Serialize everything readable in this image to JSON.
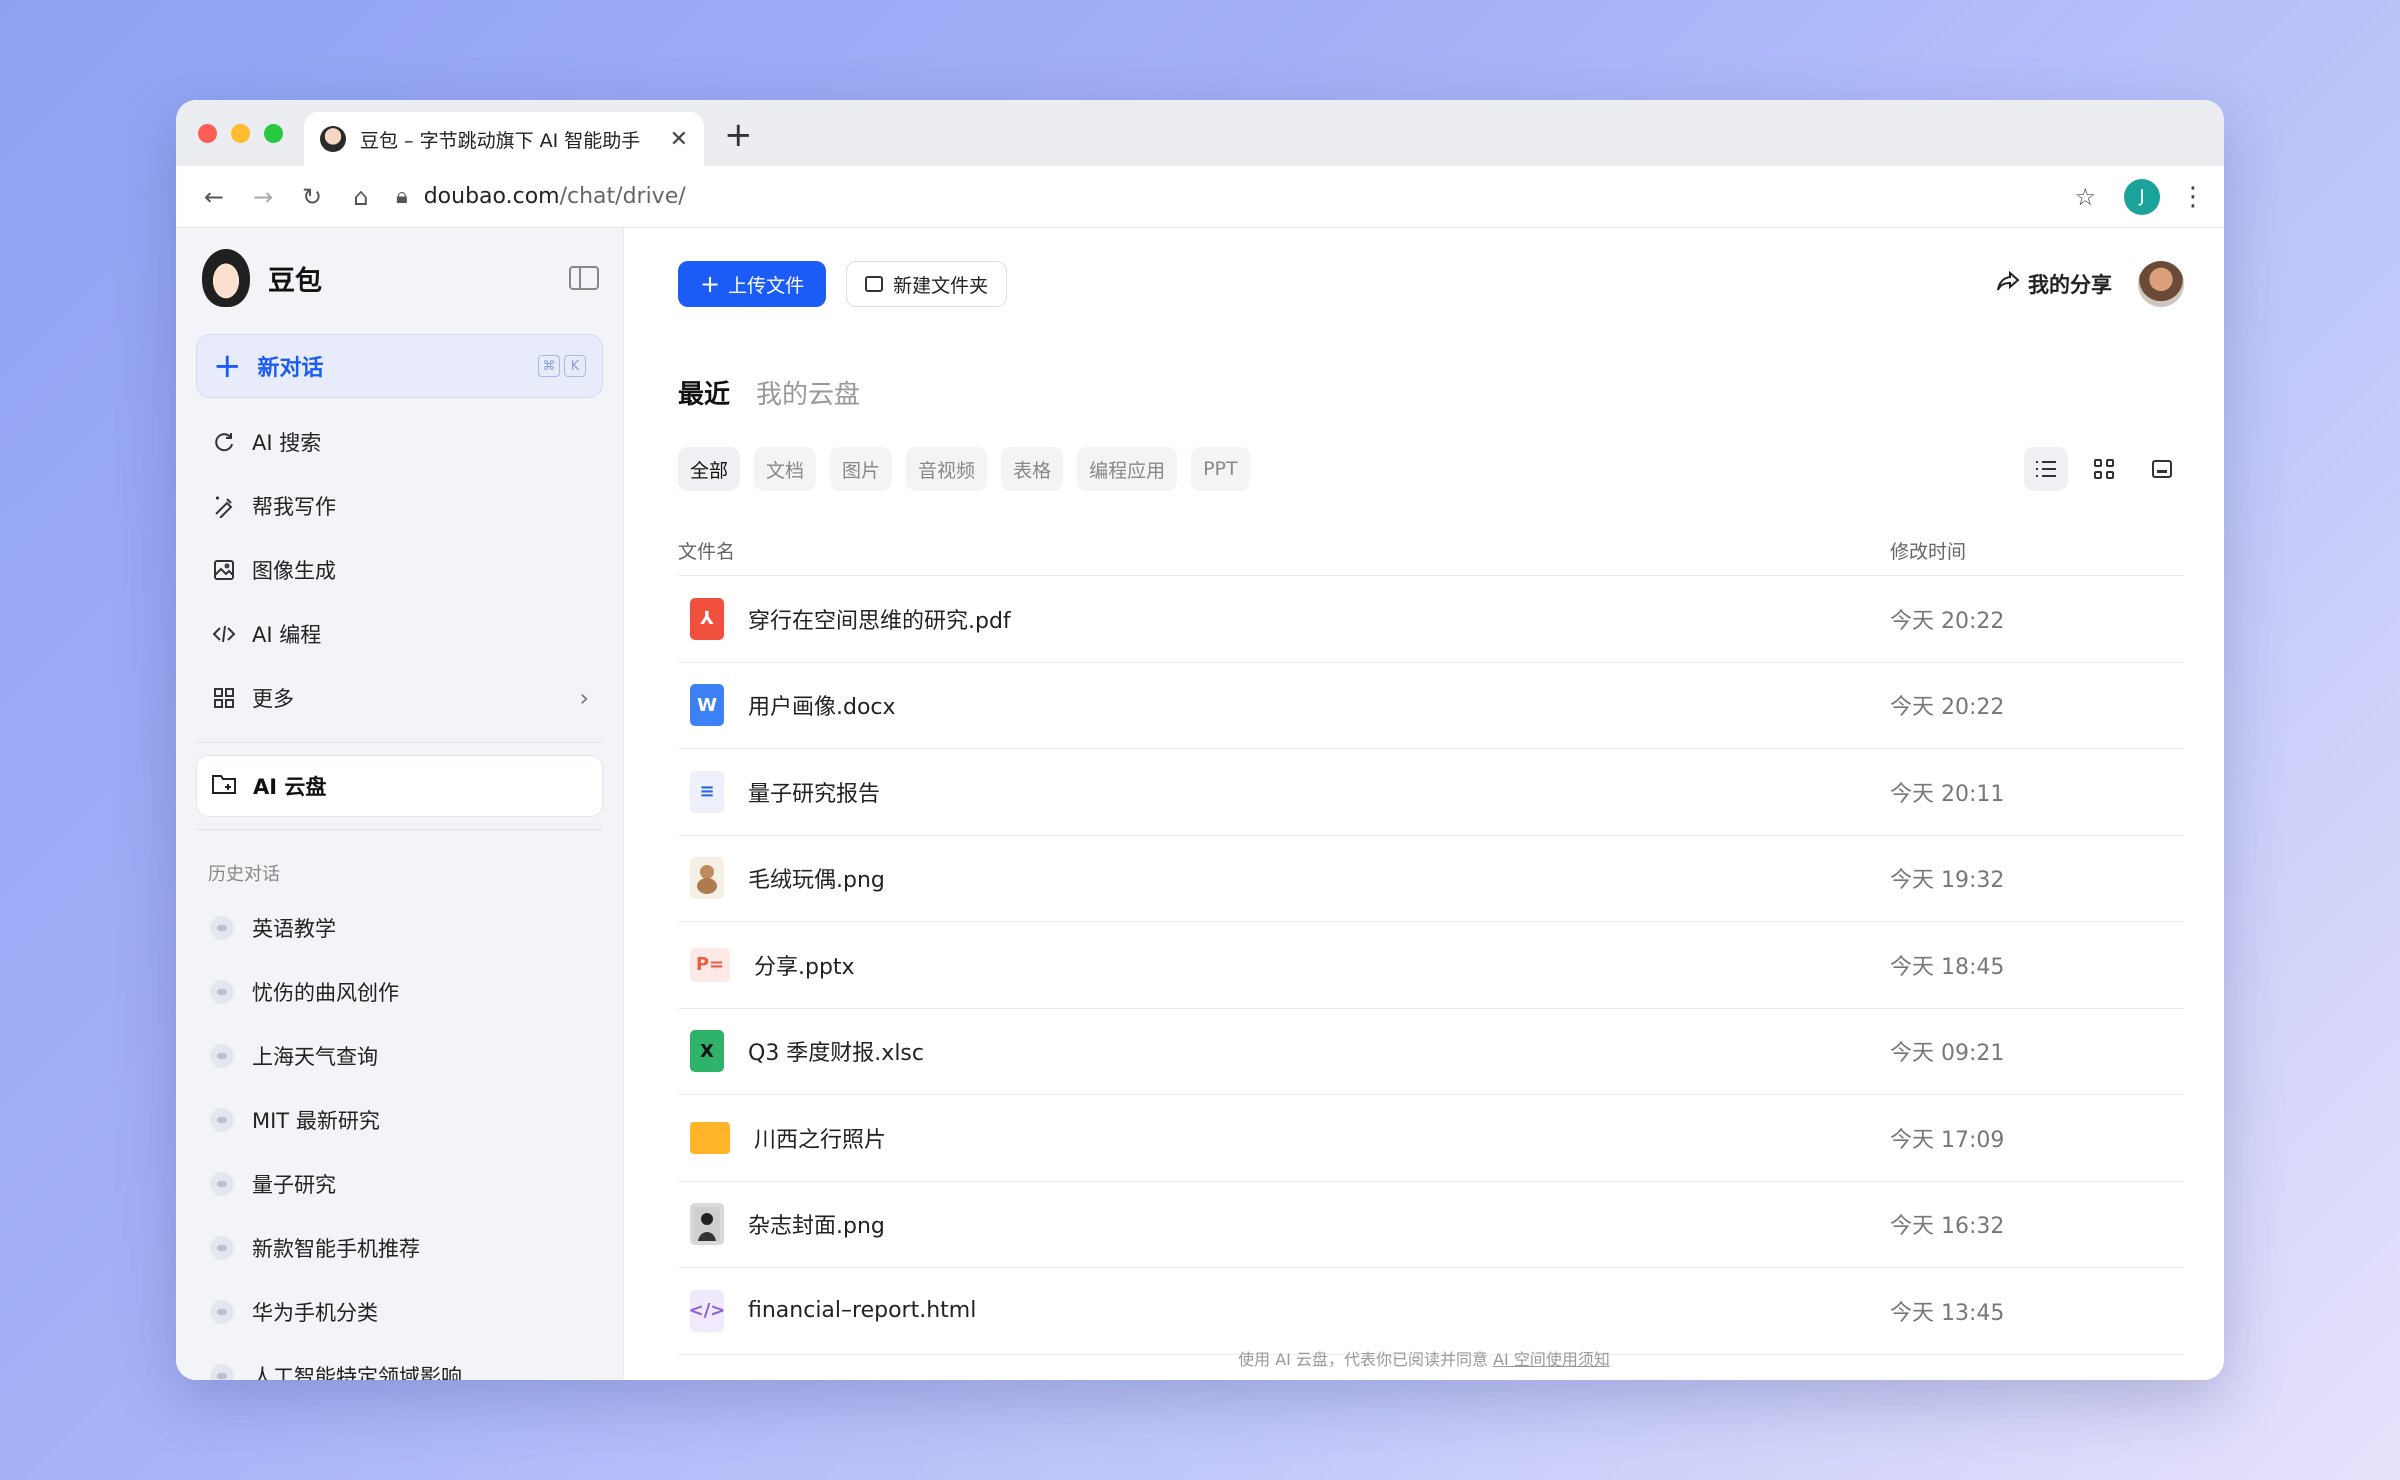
{
  "browser": {
    "tab_title": "豆包 – 字节跳动旗下 AI 智能助手",
    "url_host": "doubao.com",
    "url_path": "/chat/drive/",
    "profile_initial": "J"
  },
  "sidebar": {
    "brand": "豆包",
    "new_chat": "新对话",
    "kbd": [
      "⌘",
      "K"
    ],
    "items": [
      {
        "label": "AI 搜索",
        "icon": "search-refresh-icon"
      },
      {
        "label": "帮我写作",
        "icon": "pen-icon"
      },
      {
        "label": "图像生成",
        "icon": "image-icon"
      },
      {
        "label": "AI 编程",
        "icon": "code-icon"
      },
      {
        "label": "更多",
        "icon": "grid-icon"
      }
    ],
    "drive": "AI 云盘",
    "history_label": "历史对话",
    "history": [
      "英语教学",
      "忧伤的曲风创作",
      "上海天气查询",
      "MIT 最新研究",
      "量子研究",
      "新款智能手机推荐",
      "华为手机分类",
      "人工智能特定领域影响"
    ]
  },
  "main": {
    "upload": "上传文件",
    "new_folder": "新建文件夹",
    "share": "我的分享",
    "tabs": {
      "recent": "最近",
      "my_drive": "我的云盘"
    },
    "filters": [
      "全部",
      "文档",
      "图片",
      "音视频",
      "表格",
      "编程应用",
      "PPT"
    ],
    "table": {
      "col_name": "文件名",
      "col_time": "修改时间",
      "rows": [
        {
          "name": "穿行在空间思维的研究.pdf",
          "time": "今天 20:22",
          "type": "pdf"
        },
        {
          "name": "用户画像.docx",
          "time": "今天 20:22",
          "type": "word"
        },
        {
          "name": "量子研究报告",
          "time": "今天 20:11",
          "type": "report"
        },
        {
          "name": "毛绒玩偶.png",
          "time": "今天 19:32",
          "type": "image"
        },
        {
          "name": "分享.pptx",
          "time": "今天 18:45",
          "type": "ppt"
        },
        {
          "name": "Q3 季度财报.xlsc",
          "time": "今天 09:21",
          "type": "excel"
        },
        {
          "name": "川西之行照片",
          "time": "今天 17:09",
          "type": "folder"
        },
        {
          "name": "杂志封面.png",
          "time": "今天 16:32",
          "type": "image"
        },
        {
          "name": "financial–report.html",
          "time": "今天 13:45",
          "type": "html"
        }
      ]
    },
    "footer_text": "使用 AI 云盘，代表你已阅读并同意 ",
    "footer_link": "AI 空间使用须知"
  },
  "colors": {
    "accent": "#1a5cf5",
    "sidebar_bg": "#f3f4f7"
  }
}
